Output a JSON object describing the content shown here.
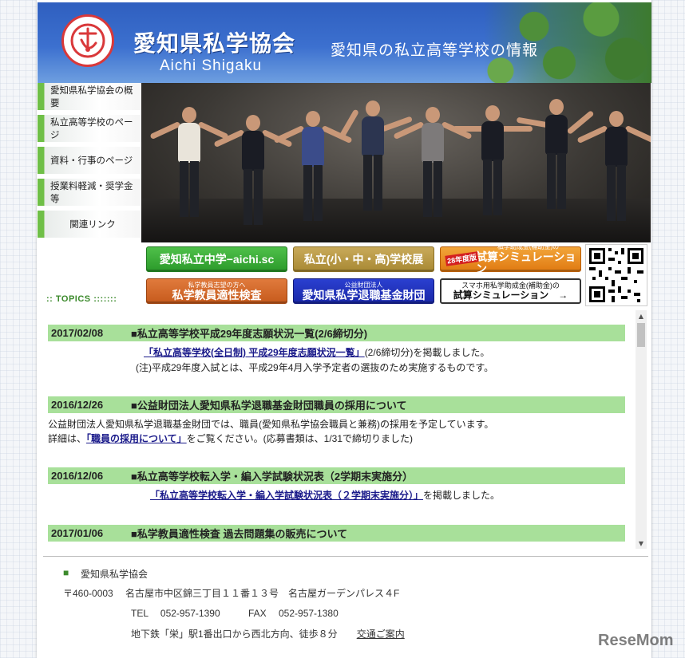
{
  "header": {
    "title": "愛知県私学協会",
    "title_en": "Aichi Shigaku",
    "tagline": "愛知県の私立高等学校の情報"
  },
  "sidebar": {
    "items": [
      {
        "label": "愛知県私学協会の概要"
      },
      {
        "label": "私立高等学校のページ"
      },
      {
        "label": "資料・行事のページ"
      },
      {
        "label": "授業料軽減・奨学金等"
      },
      {
        "label": "関連リンク"
      }
    ]
  },
  "banners": {
    "aichi_sc": "愛知私立中学−aichi.sc",
    "school_fair": "私立(小・中・高)学校展",
    "sim_tag": "28年度版",
    "sim_sub": "私学助成金(補助金)の",
    "sim_main": "試算シミュレーション",
    "exam_sub": "私学教員志望の方へ",
    "exam_main": "私学教員適性検査",
    "fund_sub": "公益財団法人",
    "fund_main": "愛知県私学退職基金財団",
    "mobile_sub": "スマホ用私学助成金(補助金)の",
    "mobile_main": "試算シミュレーション　→"
  },
  "topics": {
    "label": "TOPICS",
    "items": [
      {
        "date": "2017/02/08",
        "title": "■私立高等学校平成29年度志願状況一覧(2/6締切分)",
        "link": "「私立高等学校(全日制) 平成29年度志願状況一覧」",
        "after": "(2/6締切分)を掲載しました。",
        "note": "(注)平成29年度入試とは、平成29年4月入学予定者の選抜のため実施するものです。"
      },
      {
        "date": "2016/12/26",
        "title": "■公益財団法人愛知県私学退職基金財団職員の採用について",
        "line1": "公益財団法人愛知県私学退職基金財団では、職員(愛知県私学協会職員と兼務)の採用を予定しています。",
        "before": "詳細は、",
        "link": "「職員の採用について」",
        "after": "をご覧ください。(応募書類は、1/31で締切りました)"
      },
      {
        "date": "2016/12/06",
        "title": "■私立高等学校転入学・編入学試験状況表（2学期末実施分）",
        "link": "「私立高等学校転入学・編入学試験状況表（２学期末実施分）」",
        "after": "を掲載しました。"
      },
      {
        "date": "2017/01/06",
        "title": "■私学教員適性検査 過去問題集の販売について"
      }
    ]
  },
  "footer": {
    "org": "愛知県私学協会",
    "address": "〒460-0003　 名古屋市中区錦三丁目１１番１３号　名古屋ガーデンパレス４F",
    "tel": "TEL　 052-957-1390",
    "fax": "FAX　 052-957-1380",
    "access": "地下鉄「栄」駅1番出口から西北方向、徒歩８分",
    "access_link": "交通ご案内"
  },
  "watermark": "ReseMom",
  "colors": {
    "nav_accent": "#6fbf47",
    "topic_bar": "#a8e09a",
    "header_blue": "#3c70cf"
  }
}
